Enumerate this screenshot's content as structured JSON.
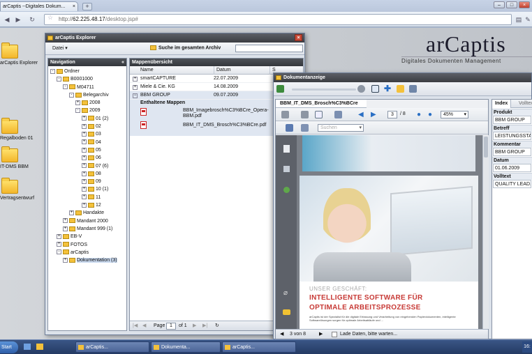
{
  "browser": {
    "tab_title": "arCaptis --Digitales Dokum...",
    "tab_close": "×",
    "new_tab": "+",
    "url_prefix": "http://",
    "url_host": "62.225.48.17",
    "url_path": "/desktop.jsp#",
    "min": "–",
    "max": "□",
    "close": "×"
  },
  "logo": {
    "text": "arCaptis",
    "subtitle": "Digitales Dokumenten Management"
  },
  "desktop_icons": [
    {
      "label": "arCaptis Explorer"
    },
    {
      "label": "Regalboden 01"
    },
    {
      "label": "IT-DMS BBM"
    },
    {
      "label": "Vertragsentwurf"
    }
  ],
  "explorer": {
    "title": "arCaptis Explorer",
    "menu_file": "Datei",
    "search_label": "Suche im gesamten Archiv",
    "nav_header": "Navigation",
    "tree": [
      {
        "label": "Ordner",
        "level": 0,
        "pm": "-"
      },
      {
        "label": "B0001000",
        "level": 1,
        "pm": "-"
      },
      {
        "label": "M04711",
        "level": 2,
        "pm": "-"
      },
      {
        "label": "Belegarchiv",
        "level": 3,
        "pm": "-"
      },
      {
        "label": "2008",
        "level": 4,
        "pm": "+"
      },
      {
        "label": "2009",
        "level": 4,
        "pm": "-"
      },
      {
        "label": "01 (2)",
        "level": 5,
        "pm": "+"
      },
      {
        "label": "02",
        "level": 5,
        "pm": "+"
      },
      {
        "label": "03",
        "level": 5,
        "pm": "+"
      },
      {
        "label": "04",
        "level": 5,
        "pm": "+"
      },
      {
        "label": "05",
        "level": 5,
        "pm": "+"
      },
      {
        "label": "06",
        "level": 5,
        "pm": "+"
      },
      {
        "label": "07 (6)",
        "level": 5,
        "pm": "+"
      },
      {
        "label": "08",
        "level": 5,
        "pm": "+"
      },
      {
        "label": "09",
        "level": 5,
        "pm": "+"
      },
      {
        "label": "10 (1)",
        "level": 5,
        "pm": "+"
      },
      {
        "label": "11",
        "level": 5,
        "pm": "+"
      },
      {
        "label": "12",
        "level": 5,
        "pm": "+"
      },
      {
        "label": "Handakte",
        "level": 3,
        "pm": "+"
      },
      {
        "label": "Mandant 2000",
        "level": 2,
        "pm": "+"
      },
      {
        "label": "Mandant 999 (1)",
        "level": 2,
        "pm": "+"
      },
      {
        "label": "EB-V",
        "level": 1,
        "pm": "+"
      },
      {
        "label": "FOTOS",
        "level": 1,
        "pm": "+"
      },
      {
        "label": "arCaptis",
        "level": 1,
        "pm": "-"
      },
      {
        "label": "Dokumentation (3)",
        "level": 2,
        "pm": "+",
        "selected": true
      }
    ],
    "mappe_header": "Mappenübersicht",
    "col_name": "Name",
    "col_date": "Datum",
    "col_s": "S",
    "rows": [
      {
        "name": "smartCAPTURE",
        "date": "22.07.2009",
        "pm": "+"
      },
      {
        "name": "Miele & Cie. KG",
        "date": "14.08.2009",
        "pm": "+"
      },
      {
        "name": "BBM GROUP",
        "date": "09.07.2009",
        "pm": "-"
      }
    ],
    "contained_label": "Enthaltene Mappen",
    "files": [
      {
        "name": "BBM_Imagebrosch%C3%BCre_Opera-BBM.pdf"
      },
      {
        "name": "BBM_IT_DMS_Brosch%C3%BCre.pdf"
      }
    ],
    "pager": {
      "page_label": "Page",
      "page_value": "1",
      "of": "of 1"
    }
  },
  "docview": {
    "title": "Dokumentanzeige",
    "pdf_tab": "BBM_IT_DMS_Brosch%C3%BCre",
    "page_current": "3",
    "page_total": "/ 8",
    "zoom": "45%",
    "search_placeholder": "Suchen",
    "page_headline": "UNSER GESCHÄFT:",
    "page_title_1": "INTELLIGENTE SOFTWARE FÜR",
    "page_title_2": "OPTIMALE ARBEITSPROZESSE",
    "page_body": "arCaptis ist der Spezialist für die digitale Erfassung und Verarbeitung von eingehenden Papierdokumenten, intelligente Softwarelösungen sorgen für optimale Arbeitsabläufe und ...",
    "status_page": "3 von 8",
    "status_loading": "Lade Daten, bitte warten...",
    "index_tab": "Index",
    "volltext_tab": "Volltext",
    "fields": [
      {
        "label": "Produkt",
        "value": "BBM GROUP"
      },
      {
        "label": "Betreff",
        "value": "LEISTUNGSSTA..."
      },
      {
        "label": "Kommentar",
        "value": "BBM GROUP"
      },
      {
        "label": "Datum",
        "value": "01.06.2009"
      },
      {
        "label": "Volltext",
        "value": "QUALITY LEAD..."
      }
    ]
  },
  "taskbar": {
    "start": "Start",
    "tasks": [
      "arCaptis...",
      "Dokumenta...",
      "arCaptis..."
    ],
    "clock": "16:"
  }
}
